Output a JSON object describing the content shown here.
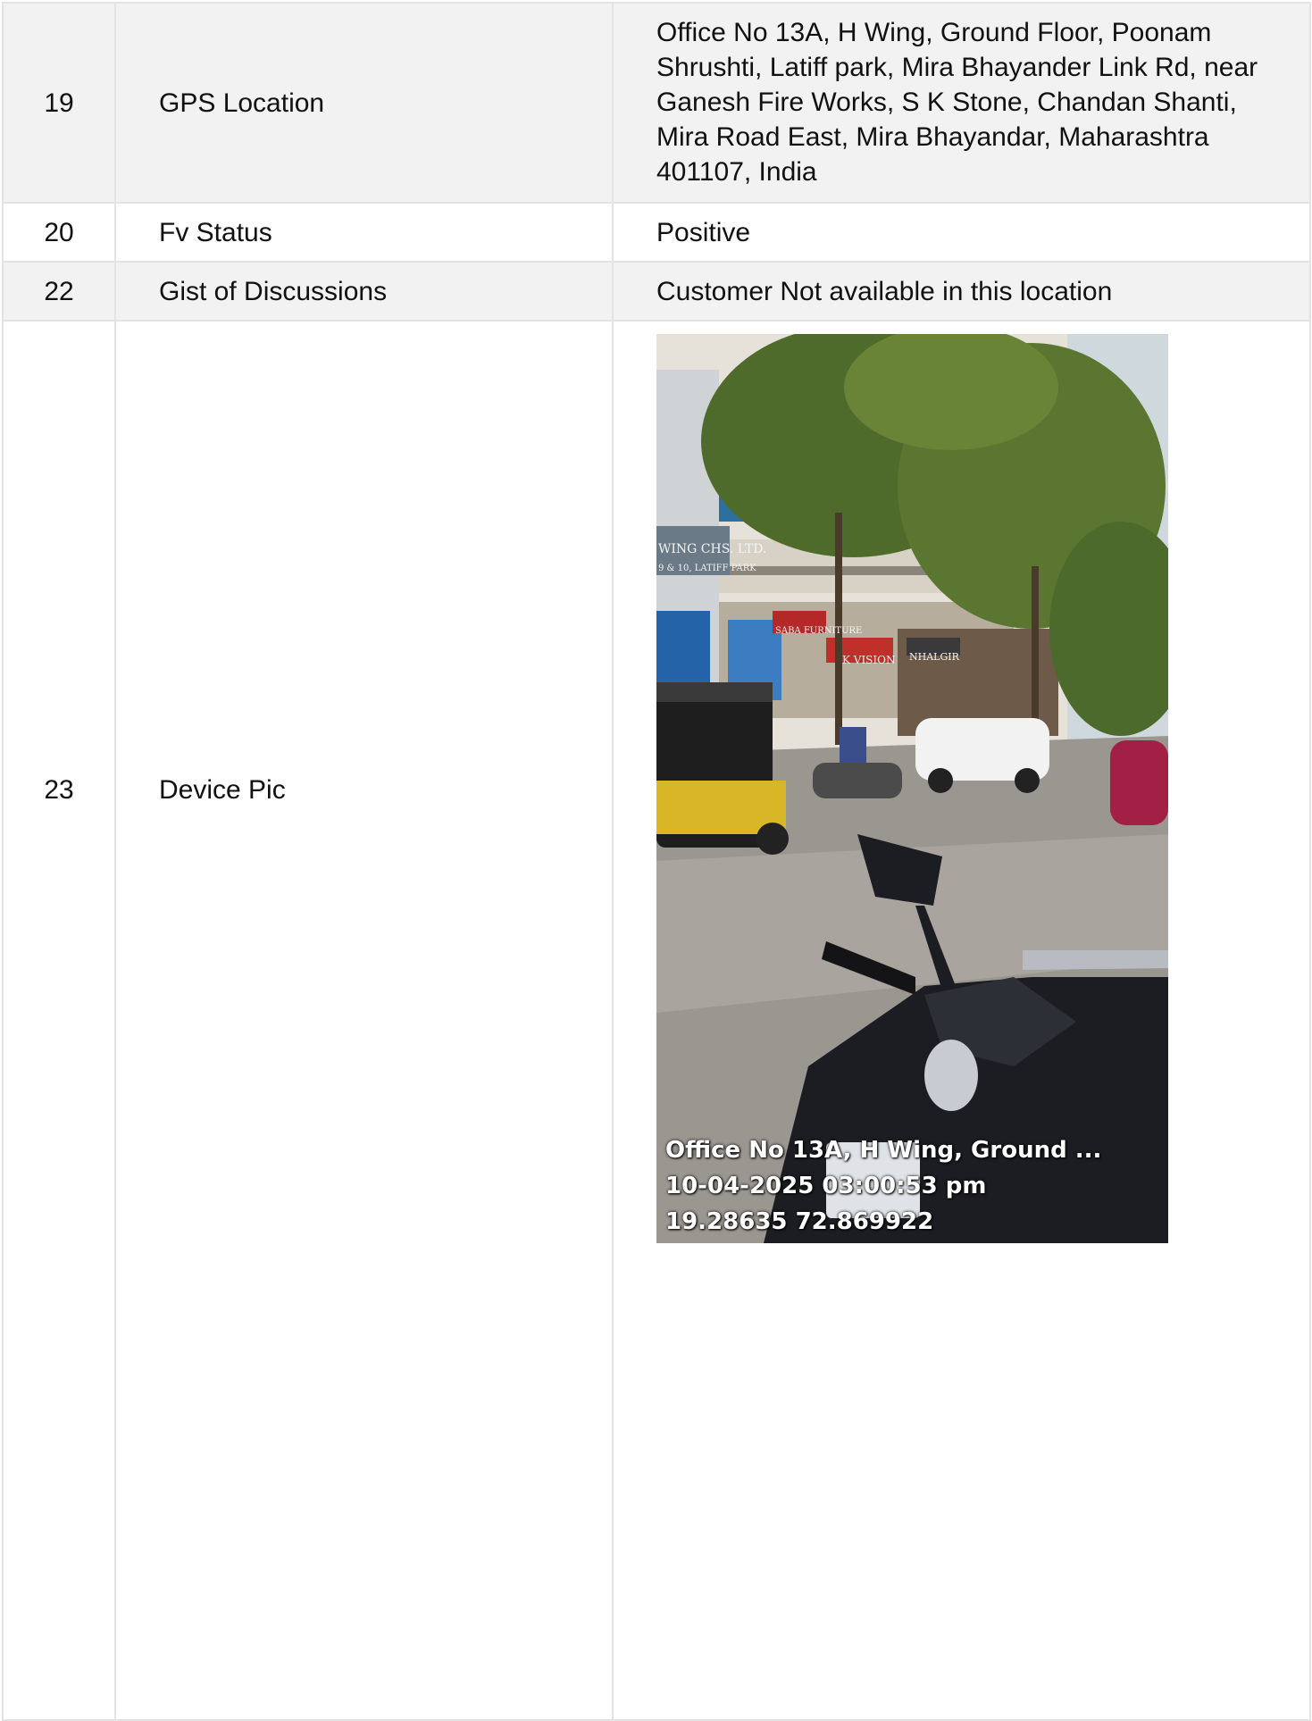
{
  "rows": [
    {
      "no": "19",
      "label": "GPS Location",
      "value": "Office No 13A, H Wing, Ground Floor, Poonam Shrushti, Latiff park, Mira Bhayander Link Rd, near Ganesh Fire Works, S K Stone, Chandan Shanti, Mira Road East, Mira Bhayandar, Maharashtra 401107, India"
    },
    {
      "no": "20",
      "label": "Fv Status",
      "value": "Positive"
    },
    {
      "no": "22",
      "label": "Gist of Discussions",
      "value": "Customer Not available in this location"
    },
    {
      "no": "23",
      "label": "Device Pic"
    }
  ],
  "photo": {
    "description_icon": "street-photo",
    "stamp": {
      "address": "Office No 13A, H Wing, Ground ...",
      "datetime": "10-04-2025 03:00:53 pm",
      "coordinates": "19.28635 72.869922"
    },
    "signs": {
      "society": "WING CHS. LTD.",
      "society_sub": "9 & 10, LATIFF PARK",
      "shop1": "SABA FURNITURE",
      "shop2": "K VISION",
      "shop3": "NHALGIR"
    },
    "colors": {
      "sky": "#cfd8dc",
      "building": "#e6e2da",
      "tree": "#4f6b2c",
      "road": "#9a9690",
      "scooter": "#1b1d22"
    }
  }
}
